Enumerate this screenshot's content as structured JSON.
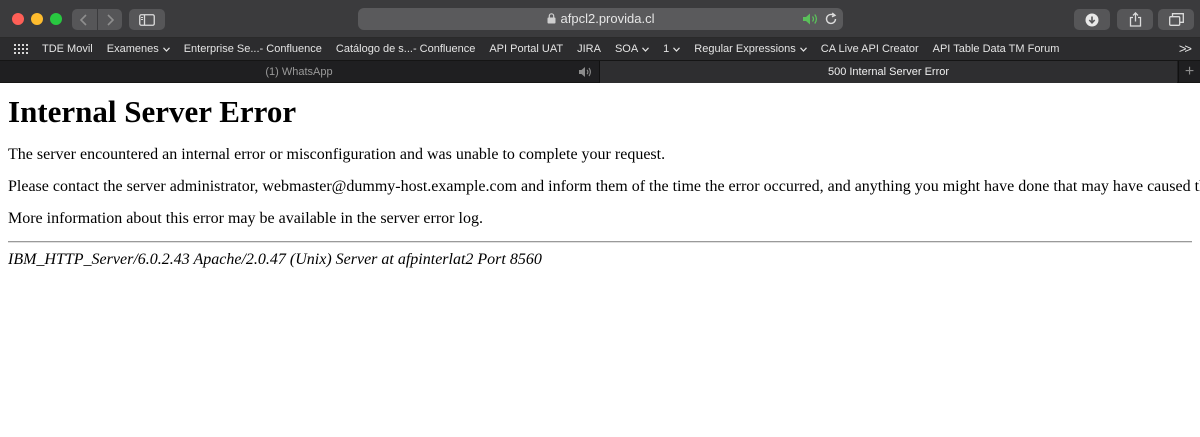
{
  "browser": {
    "url": "afpcl2.provida.cl"
  },
  "bookmarks": [
    {
      "label": "TDE Movil",
      "menu": false
    },
    {
      "label": "Examenes",
      "menu": true
    },
    {
      "label": "Enterprise Se...- Confluence",
      "menu": false
    },
    {
      "label": "Catálogo de s...- Confluence",
      "menu": false
    },
    {
      "label": "API Portal UAT",
      "menu": false
    },
    {
      "label": "JIRA",
      "menu": false
    },
    {
      "label": "SOA",
      "menu": true
    },
    {
      "label": "1",
      "menu": true
    },
    {
      "label": "Regular Expressions",
      "menu": true
    },
    {
      "label": "CA Live API Creator",
      "menu": false
    },
    {
      "label": "API Table Data TM Forum",
      "menu": false
    }
  ],
  "bookmarks_overflow": ">>",
  "tabs": [
    {
      "title": "(1) WhatsApp",
      "active": false,
      "audio": true
    },
    {
      "title": "500 Internal Server Error",
      "active": true,
      "audio": false
    }
  ],
  "page": {
    "heading": "Internal Server Error",
    "paragraph_1": "The server encountered an internal error or misconfiguration and was unable to complete your request.",
    "paragraph_2": "Please contact the server administrator, webmaster@dummy-host.example.com and inform them of the time the error occurred, and anything you might have done that may have caused the error.",
    "paragraph_3": "More information about this error may be available in the server error log.",
    "server_signature": "IBM_HTTP_Server/6.0.2.43 Apache/2.0.47 (Unix) Server at afpinterlat2 Port 8560"
  },
  "colors": {
    "toolbar": "#3b3b3d",
    "bookmarks_bar": "#2c2c2e",
    "audio_active": "#5ac05a"
  }
}
